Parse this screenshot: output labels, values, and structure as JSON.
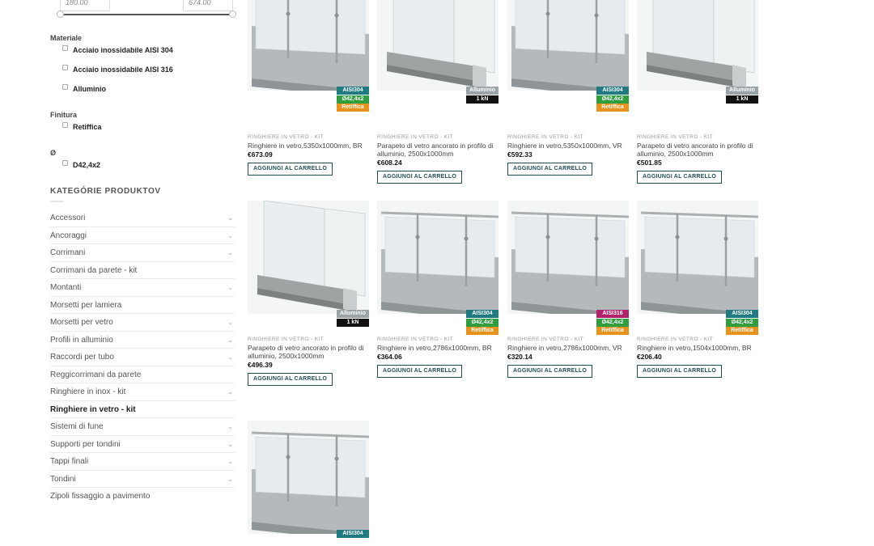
{
  "price_filter": {
    "min_value": "180.00",
    "max_value": "674.00"
  },
  "filters": {
    "materiale": {
      "title": "Materiale",
      "options": [
        "Acciaio inossidabile AISI 304",
        "Acciaio inossidabile AISI 316",
        "Alluminio"
      ]
    },
    "finitura": {
      "title": "Finitura",
      "options": [
        "Retiffica"
      ]
    },
    "diametro": {
      "title": "Ø",
      "options": [
        "D42,4x2"
      ]
    }
  },
  "categories": {
    "heading": "KATEGÓRIE PRODUKTOV",
    "items": [
      {
        "label": "Accessori",
        "expandable": true
      },
      {
        "label": "Ancoraggi",
        "expandable": true
      },
      {
        "label": "Corrimani",
        "expandable": true
      },
      {
        "label": "Corrimani da parete - kit",
        "expandable": false
      },
      {
        "label": "Montanti",
        "expandable": true
      },
      {
        "label": "Morsetti per lamiera",
        "expandable": false
      },
      {
        "label": "Morsetti per vetro",
        "expandable": true
      },
      {
        "label": "Profili in alluminio",
        "expandable": true
      },
      {
        "label": "Raccordi per tubo",
        "expandable": true
      },
      {
        "label": "Reggicorrimani da parete",
        "expandable": false
      },
      {
        "label": "Ringhiere in inox - kit",
        "expandable": true
      },
      {
        "label": "Ringhiere in vetro - kit",
        "expandable": false,
        "active": true
      },
      {
        "label": "Sistemi di fune",
        "expandable": true
      },
      {
        "label": "Supporti per tondini",
        "expandable": true
      },
      {
        "label": "Tappi finali",
        "expandable": true
      },
      {
        "label": "Tondini",
        "expandable": true
      },
      {
        "label": "Zipoli fissaggio a pavimento",
        "expandable": false
      }
    ]
  },
  "colors": {
    "aisi304": "#1f7a82",
    "aisi316": "#b0236a",
    "diameter": "#2e9e3e",
    "retiffica": "#e8921e",
    "alluminio": "#9aa3a6",
    "kn": "#111111",
    "button_border": "#1f4e55"
  },
  "products": [
    {
      "category": "RINGHIERE IN VETRO - KIT",
      "title": "Ringhiere in vetro,5350x1000mm, BR",
      "price": "€673.09",
      "cart_label": "AGGIUNGI AL CARRELLO",
      "badges": [
        "AISI304",
        "Ø42,4x2",
        "Retiffica"
      ],
      "image": "posts-railing"
    },
    {
      "category": "RINGHIERE IN VETRO - KIT",
      "title": "Parapeto di vetro ancorato in profilo di alluminio, 2500x1000mm",
      "price": "€608.24",
      "cart_label": "AGGIUNGI AL CARRELLO",
      "badges": [
        "Alluminio",
        "1 kN"
      ],
      "image": "profile-glass"
    },
    {
      "category": "RINGHIERE IN VETRO - KIT",
      "title": "Ringhiere in vetro,5350x1000mm, VR",
      "price": "€592.33",
      "cart_label": "AGGIUNGI AL CARRELLO",
      "badges": [
        "AISI304",
        "Ø42,4x2",
        "Retiffica"
      ],
      "image": "posts-railing"
    },
    {
      "category": "RINGHIERE IN VETRO - KIT",
      "title": "Parapeto di vetro ancorato in profilo di alluminio, 2500x1000mm",
      "price": "€501.85",
      "cart_label": "AGGIUNGI AL CARRELLO",
      "badges": [
        "Alluminio",
        "1 kN"
      ],
      "image": "profile-glass"
    },
    {
      "category": "RINGHIERE IN VETRO - KIT",
      "title": "Parapeto di vetro ancorato in profilo di alluminio, 2500x1000mm",
      "price": "€496.39",
      "cart_label": "AGGIUNGI AL CARRELLO",
      "badges": [
        "Alluminio",
        "1 kN"
      ],
      "image": "profile-glass"
    },
    {
      "category": "RINGHIERE IN VETRO - KIT",
      "title": "Ringhiere in vetro,2786x1000mm, BR",
      "price": "€364.06",
      "cart_label": "AGGIUNGI AL CARRELLO",
      "badges": [
        "AISI304",
        "Ø42,4x2",
        "Retiffica"
      ],
      "image": "posts-railing"
    },
    {
      "category": "RINGHIERE IN VETRO - KIT",
      "title": "Ringhiere in vetro,2786x1000mm, VR",
      "price": "€320.14",
      "cart_label": "AGGIUNGI AL CARRELLO",
      "badges": [
        "AISI316",
        "Ø42,4x2",
        "Retiffica"
      ],
      "image": "posts-railing"
    },
    {
      "category": "RINGHIERE IN VETRO - KIT",
      "title": "Ringhiere in vetro,1504x1000mm, BR",
      "price": "€206.40",
      "cart_label": "AGGIUNGI AL CARRELLO",
      "badges": [
        "AISI304",
        "Ø42,4x2",
        "Retiffica"
      ],
      "image": "posts-railing"
    },
    {
      "category": "",
      "title": "",
      "price": "",
      "cart_label": "",
      "badges": [
        "AISI304"
      ],
      "image": "posts-railing"
    }
  ]
}
